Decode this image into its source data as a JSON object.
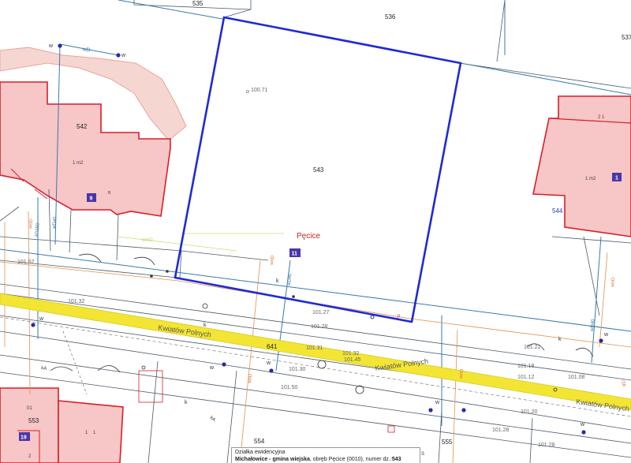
{
  "colors": {
    "building_fill": "#f7c6c6",
    "building_stroke": "#d81e2a",
    "selected_parcel": "#1f2ad6",
    "parcel_line": "#4a5a6a",
    "utility_line": "#3a7aa8",
    "road_band": "#f2e534",
    "badge": "#4a36a8",
    "place_name": "#cc1f1f"
  },
  "parcels": {
    "n535": "535",
    "n536": "536",
    "n537": "537",
    "n542": "542",
    "n543": "543",
    "n544": "544",
    "n553": "553",
    "n554": "554",
    "n555": "555",
    "n641": "641"
  },
  "place_name": "Pęcice",
  "streets": {
    "left": "Kwiatów Polnych",
    "middle": "Kwiatów Polnych",
    "right": "Kwiatów Polnych"
  },
  "badges": {
    "b9": "9",
    "b11": "11",
    "b1": "1",
    "b19": "19"
  },
  "building_labels": {
    "left": "1 m2",
    "right": "1 m2",
    "small_21": "2 1",
    "letter_left": "B",
    "bl_01": "01",
    "bl_1a": "1",
    "bl_1b": "1",
    "bl_2": "2"
  },
  "elevations": [
    "100.71",
    "101.52",
    "101.32",
    "101.27",
    "101.28",
    "101.31",
    "101.32",
    "101.45",
    "101.30",
    "101.50",
    "101.18",
    "101.12",
    "101.08",
    "101.22",
    "101.20",
    "101.28",
    "101.28"
  ],
  "utility_labels": {
    "w": "w",
    "k": "k",
    "wD": "wD",
    "wD40": "wD40",
    "kD150": "kD150",
    "wnD": "wnD",
    "wmD": "wmD",
    "kA": "kA",
    "p": "p",
    "s": "S",
    "gD": "gD"
  },
  "info": {
    "title": "Działka ewidencyjna",
    "line_bold": "Michałowice - gmina wiejska",
    "line_mid": ", obręb Pęcice (0010), numer dz.:",
    "parcel_no": "543"
  }
}
